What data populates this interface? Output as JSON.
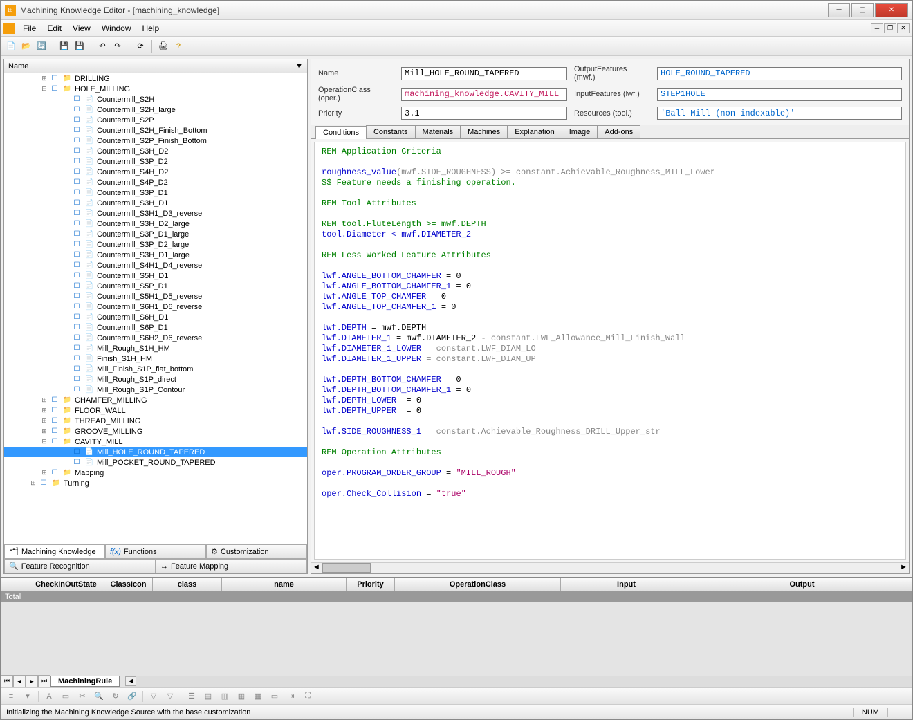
{
  "app": {
    "title": "Machining Knowledge Editor - [machining_knowledge]"
  },
  "menus": [
    "File",
    "Edit",
    "View",
    "Window",
    "Help"
  ],
  "tree_header": "Name",
  "tree": {
    "top": [
      {
        "label": "DRILLING",
        "indent": 3,
        "toggle": "+",
        "type": "folder"
      }
    ],
    "hole_milling": {
      "label": "HOLE_MILLING",
      "children": [
        "Countermill_S2H",
        "Countermill_S2H_large",
        "Countermill_S2P",
        "Countermill_S2H_Finish_Bottom",
        "Countermill_S2P_Finish_Bottom",
        "Countermill_S3H_D2",
        "Countermill_S3P_D2",
        "Countermill_S4H_D2",
        "Countermill_S4P_D2",
        "Countermill_S3P_D1",
        "Countermill_S3H_D1",
        "Countermill_S3H1_D3_reverse",
        "Countermill_S3H_D2_large",
        "Countermill_S3P_D1_large",
        "Countermill_S3P_D2_large",
        "Countermill_S3H_D1_large",
        "Countermill_S4H1_D4_reverse",
        "Countermill_S5H_D1",
        "Countermill_S5P_D1",
        "Countermill_S5H1_D5_reverse",
        "Countermill_S6H1_D6_reverse",
        "Countermill_S6H_D1",
        "Countermill_S6P_D1",
        "Countermill_S6H2_D6_reverse",
        "Mill_Rough_S1H_HM",
        "Finish_S1H_HM",
        "Mill_Finish_S1P_flat_bottom",
        "Mill_Rough_S1P_direct",
        "Mill_Rough_S1P_Contour"
      ]
    },
    "siblings_after": [
      {
        "label": "CHAMFER_MILLING",
        "toggle": "+"
      },
      {
        "label": "FLOOR_WALL",
        "toggle": "+"
      },
      {
        "label": "THREAD_MILLING",
        "toggle": "+"
      },
      {
        "label": "GROOVE_MILLING",
        "toggle": "+"
      }
    ],
    "cavity_mill": {
      "label": "CAVITY_MILL",
      "children": [
        "Mill_HOLE_ROUND_TAPERED",
        "Mill_POCKET_ROUND_TAPERED"
      ]
    },
    "after_cavity": [
      {
        "label": "Mapping",
        "toggle": "+",
        "indent": 3
      },
      {
        "label": "Turning",
        "toggle": "+",
        "indent": 2
      }
    ],
    "selected": "Mill_HOLE_ROUND_TAPERED"
  },
  "bottom_tabs": [
    "Machining Knowledge",
    "Functions",
    "Customization",
    "Feature Recognition",
    "Feature Mapping"
  ],
  "form": {
    "labels": {
      "name": "Name",
      "opclass": "OperationClass (oper.)",
      "priority": "Priority",
      "outfeat": "OutputFeatures (mwf.)",
      "infeat": "InputFeatures (lwf.)",
      "resources": "Resources (tool.)"
    },
    "values": {
      "name": "Mill_HOLE_ROUND_TAPERED",
      "opclass": "machining_knowledge.CAVITY_MILL",
      "priority": "3.1",
      "outfeat": "HOLE_ROUND_TAPERED",
      "infeat": "STEP1HOLE",
      "resources": "'Ball Mill (non indexable)'"
    }
  },
  "tabs": [
    "Conditions",
    "Constants",
    "Materials",
    "Machines",
    "Explanation",
    "Image",
    "Add-ons"
  ],
  "code_lines": [
    {
      "t": "REM Application Criteria",
      "c": "green"
    },
    {
      "t": "",
      "c": ""
    },
    {
      "segs": [
        {
          "t": "roughness_value",
          "c": "blue"
        },
        {
          "t": "(mwf.SIDE_ROUGHNESS) >= constant.Achievable_Roughness_MILL_Lower",
          "c": "gray"
        }
      ]
    },
    {
      "t": "$$ Feature needs a finishing operation.",
      "c": "green"
    },
    {
      "t": "",
      "c": ""
    },
    {
      "t": "REM Tool Attributes",
      "c": "green"
    },
    {
      "t": "",
      "c": ""
    },
    {
      "t": "REM tool.FluteLength >= mwf.DEPTH",
      "c": "green"
    },
    {
      "segs": [
        {
          "t": "tool.Diameter < mwf.DIAMETER_2",
          "c": "blue"
        }
      ]
    },
    {
      "t": "",
      "c": ""
    },
    {
      "t": "REM Less Worked Feature Attributes",
      "c": "green"
    },
    {
      "t": "",
      "c": ""
    },
    {
      "segs": [
        {
          "t": "lwf.ANGLE_BOTTOM_CHAMFER",
          "c": "blue"
        },
        {
          "t": " = 0",
          "c": ""
        }
      ]
    },
    {
      "segs": [
        {
          "t": "lwf.ANGLE_BOTTOM_CHAMFER_1",
          "c": "blue"
        },
        {
          "t": " = 0",
          "c": ""
        }
      ]
    },
    {
      "segs": [
        {
          "t": "lwf.ANGLE_TOP_CHAMFER",
          "c": "blue"
        },
        {
          "t": " = 0",
          "c": ""
        }
      ]
    },
    {
      "segs": [
        {
          "t": "lwf.ANGLE_TOP_CHAMFER_1",
          "c": "blue"
        },
        {
          "t": " = 0",
          "c": ""
        }
      ]
    },
    {
      "t": "",
      "c": ""
    },
    {
      "segs": [
        {
          "t": "lwf.DEPTH",
          "c": "blue"
        },
        {
          "t": " = mwf.DEPTH",
          "c": ""
        }
      ]
    },
    {
      "segs": [
        {
          "t": "lwf.DIAMETER_1",
          "c": "blue"
        },
        {
          "t": " = mwf.DIAMETER_2 ",
          "c": ""
        },
        {
          "t": "- constant.LWF_Allowance_Mill_Finish_Wall",
          "c": "gray"
        }
      ]
    },
    {
      "segs": [
        {
          "t": "lwf.DIAMETER_1_LOWER",
          "c": "blue"
        },
        {
          "t": " = constant.LWF_DIAM_LO",
          "c": "gray"
        }
      ]
    },
    {
      "segs": [
        {
          "t": "lwf.DIAMETER_1_UPPER",
          "c": "blue"
        },
        {
          "t": " = constant.LWF_DIAM_UP",
          "c": "gray"
        }
      ]
    },
    {
      "t": "",
      "c": ""
    },
    {
      "segs": [
        {
          "t": "lwf.DEPTH_BOTTOM_CHAMFER",
          "c": "blue"
        },
        {
          "t": " = 0",
          "c": ""
        }
      ]
    },
    {
      "segs": [
        {
          "t": "lwf.DEPTH_BOTTOM_CHAMFER_1",
          "c": "blue"
        },
        {
          "t": " = 0",
          "c": ""
        }
      ]
    },
    {
      "segs": [
        {
          "t": "lwf.DEPTH_LOWER",
          "c": "blue"
        },
        {
          "t": "  = 0",
          "c": ""
        }
      ]
    },
    {
      "segs": [
        {
          "t": "lwf.DEPTH_UPPER",
          "c": "blue"
        },
        {
          "t": "  = 0",
          "c": ""
        }
      ]
    },
    {
      "t": "",
      "c": ""
    },
    {
      "segs": [
        {
          "t": "lwf.SIDE_ROUGHNESS_1",
          "c": "blue"
        },
        {
          "t": " = constant.Achievable_Roughness_DRILL_Upper_str",
          "c": "gray"
        }
      ]
    },
    {
      "t": "",
      "c": ""
    },
    {
      "t": "REM Operation Attributes",
      "c": "green"
    },
    {
      "t": "",
      "c": ""
    },
    {
      "segs": [
        {
          "t": "oper.PROGRAM_ORDER_GROUP",
          "c": "blue"
        },
        {
          "t": " = ",
          "c": ""
        },
        {
          "t": "\"MILL_ROUGH\"",
          "c": "str"
        }
      ]
    },
    {
      "t": "",
      "c": ""
    },
    {
      "segs": [
        {
          "t": "oper.Check_Collision",
          "c": "blue"
        },
        {
          "t": " = ",
          "c": ""
        },
        {
          "t": "\"true\"",
          "c": "str"
        }
      ]
    }
  ],
  "grid": {
    "columns": [
      "CheckInOutState",
      "ClassIcon",
      "class",
      "name",
      "Priority",
      "OperationClass",
      "Input",
      "Output"
    ],
    "total": "Total"
  },
  "sheet_tab": "MachiningRule",
  "status": {
    "msg": "Initializing the Machining Knowledge Source with the base customization",
    "num": "NUM"
  }
}
